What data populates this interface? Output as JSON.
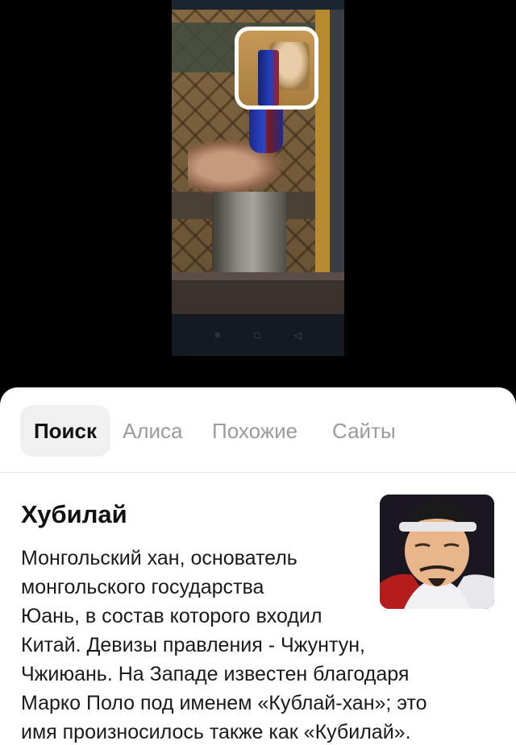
{
  "preview": {
    "nav_buttons": [
      "≡",
      "□",
      "◁"
    ]
  },
  "tabs": [
    {
      "label": "Поиск",
      "active": true
    },
    {
      "label": "Алиса",
      "active": false
    },
    {
      "label": "Похожие",
      "active": false
    },
    {
      "label": "Сайты",
      "active": false
    }
  ],
  "entity": {
    "title": "Хубилай",
    "description_lines": [
      "Монгольский хан, основатель",
      "монгольского государства",
      "Юань, в состав которого входил",
      "Китай. Девизы правления - Чжунтун,",
      "Чжиюань. На Западе известен благодаря",
      "Марко Поло под именем «Кублай-хан»; это",
      "имя произносилось также как «Кубилай»."
    ]
  },
  "colors": {
    "sheet_bg": "#ffffff",
    "active_tab_bg": "#f0f0f0",
    "inactive_tab_text": "#9b9b9b"
  }
}
